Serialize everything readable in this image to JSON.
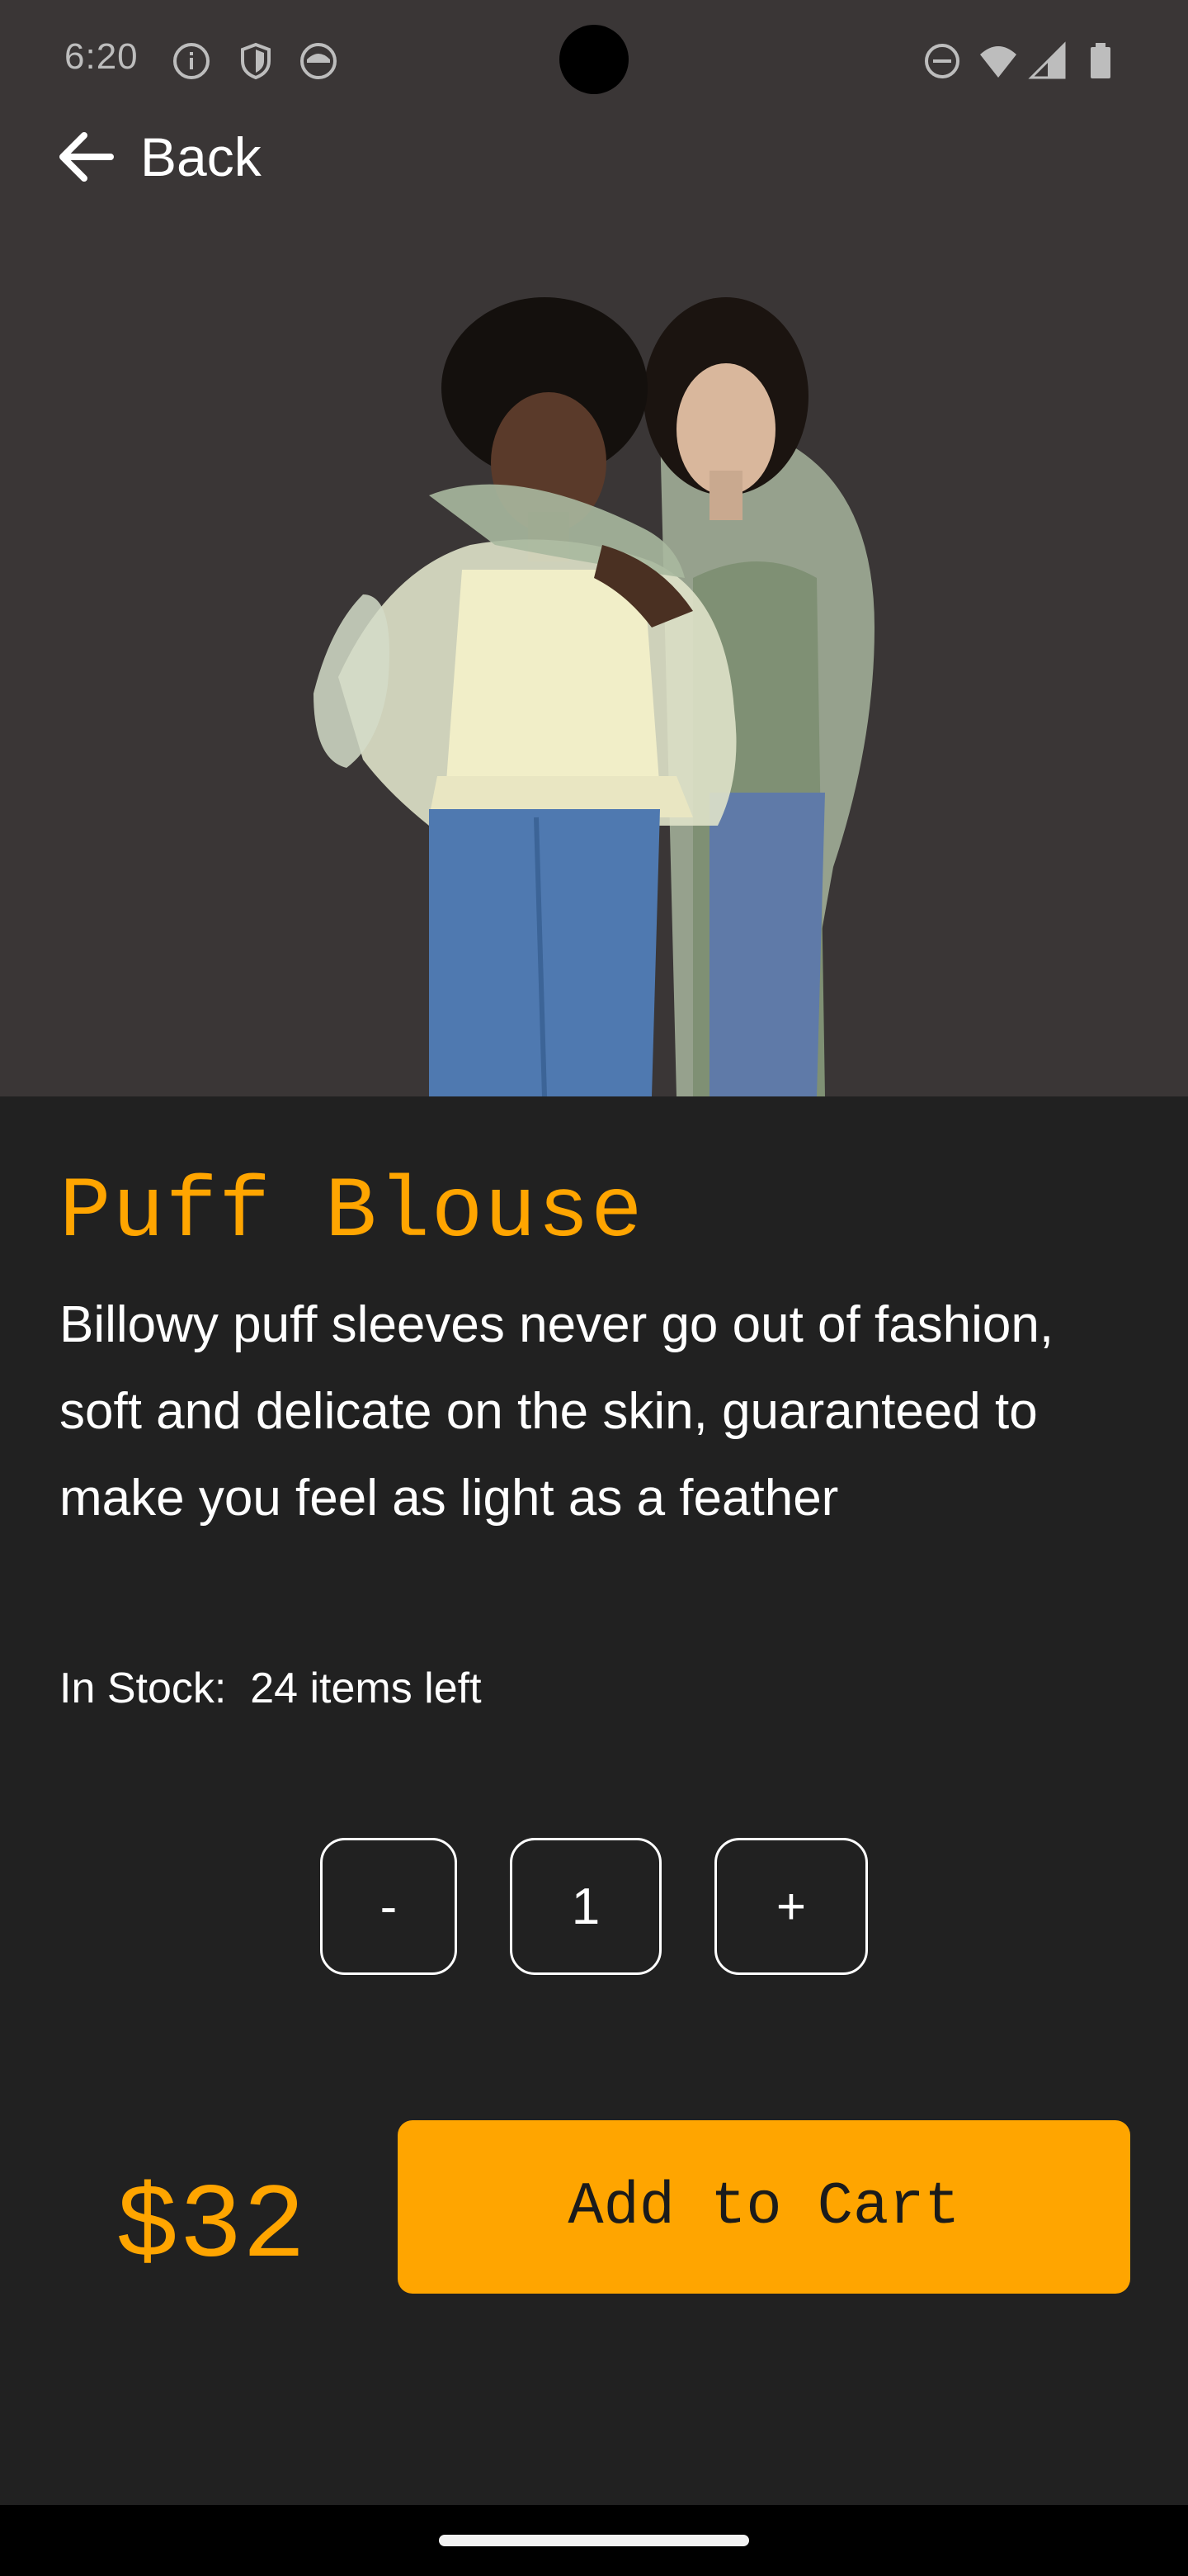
{
  "status_bar": {
    "time": "6:20",
    "left_icons": [
      "info-icon",
      "shield-icon",
      "face-icon"
    ],
    "right_icons": [
      "do-not-disturb-icon",
      "wifi-icon",
      "signal-icon",
      "battery-icon"
    ]
  },
  "header": {
    "back_label": "Back",
    "back_icon": "arrow-left-icon"
  },
  "hero": {
    "image": "two-models-in-sheer-puff-blouses-photo",
    "background_color": "#3a3636"
  },
  "product": {
    "title": "Puff Blouse",
    "description": "Billowy puff sleeves never go out of fashion, soft and delicate on the skin, guaranteed to make you feel as light as a feather",
    "stock_label": "In Stock:  24 items left",
    "price": "$32"
  },
  "quantity": {
    "decrement_label": "-",
    "value": "1",
    "increment_label": "+"
  },
  "cta": {
    "add_to_cart_label": "Add to Cart"
  },
  "colors": {
    "accent": "#ffa500",
    "background": "#212121",
    "hero_background": "#3a3636",
    "text": "#ffffff"
  }
}
